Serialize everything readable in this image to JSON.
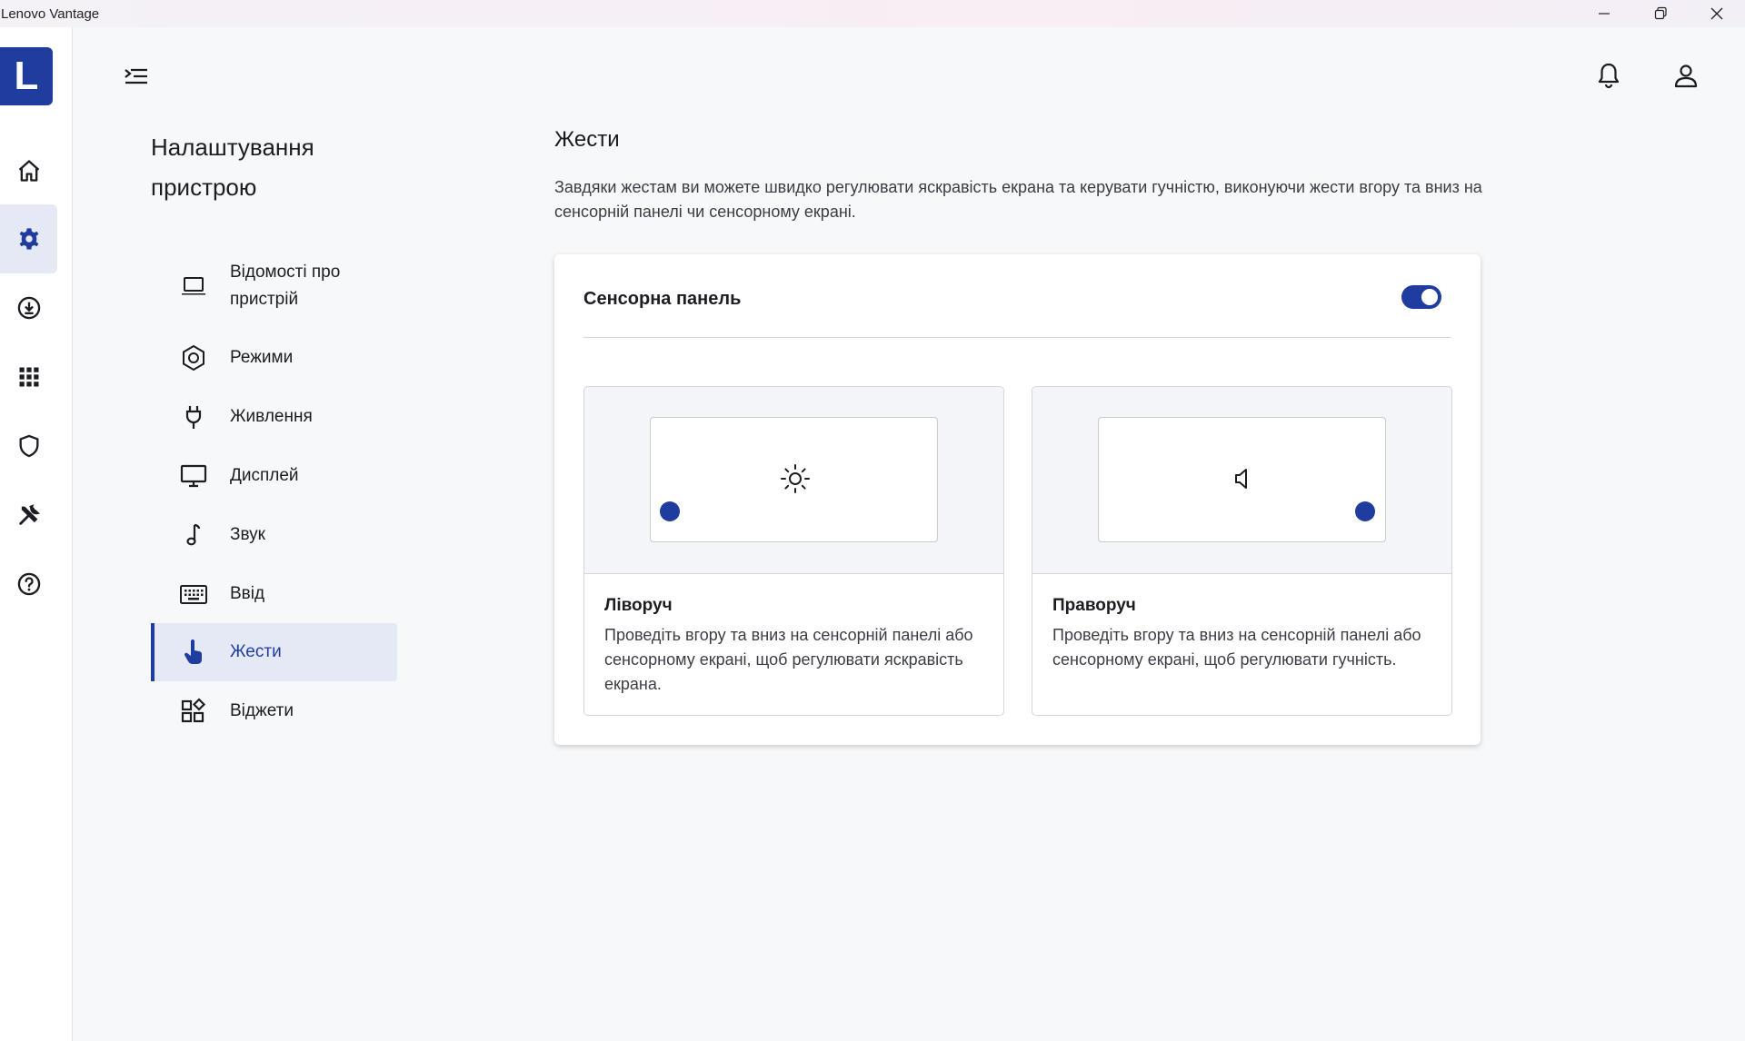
{
  "window": {
    "title": "Lenovo Vantage",
    "controls": [
      "minimize-icon",
      "restore-icon",
      "close-icon"
    ]
  },
  "rail": {
    "logo_letter": "L",
    "items": [
      {
        "icon": "home-icon",
        "active": false
      },
      {
        "icon": "gear-icon",
        "active": true
      },
      {
        "icon": "download-icon",
        "active": false
      },
      {
        "icon": "apps-grid-icon",
        "active": false
      },
      {
        "icon": "shield-icon",
        "active": false
      },
      {
        "icon": "tools-icon",
        "active": false
      },
      {
        "icon": "help-icon",
        "active": false
      }
    ]
  },
  "header": {
    "menu_icon": "collapse-menu-icon",
    "notifications_icon": "bell-icon",
    "account_icon": "user-icon"
  },
  "sidebar": {
    "title": "Налаштування пристрою",
    "items": [
      {
        "label": "Відомості про пристрій",
        "icon": "laptop-icon"
      },
      {
        "label": "Режими",
        "icon": "hexagon-icon"
      },
      {
        "label": "Живлення",
        "icon": "plug-icon"
      },
      {
        "label": "Дисплей",
        "icon": "monitor-icon"
      },
      {
        "label": "Звук",
        "icon": "music-note-icon"
      },
      {
        "label": "Ввід",
        "icon": "keyboard-icon"
      },
      {
        "label": "Жести",
        "icon": "touch-hand-icon",
        "active": true
      },
      {
        "label": "Віджети",
        "icon": "widgets-icon"
      }
    ]
  },
  "main": {
    "heading": "Жести",
    "description": "Завдяки жестам ви можете швидко регулювати яскравість екрана та керувати гучністю, виконуючи жести вгору та вниз на сенсорній панелі чи сенсорному екрані.",
    "card": {
      "title": "Сенсорна панель",
      "toggle_on": true,
      "options": [
        {
          "title": "Ліворуч",
          "description": "Проведіть вгору та вниз на сенсорній панелі або сенсорному екрані, щоб регулювати яскравість екрана.",
          "icon": "brightness-icon",
          "dot_side": "left"
        },
        {
          "title": "Праворуч",
          "description": "Проведіть вгору та вниз на сенсорній панелі або сенсорному екрані, щоб регулювати гучність.",
          "icon": "speaker-icon",
          "dot_side": "right"
        }
      ]
    }
  },
  "colors": {
    "accent": "#1f3d9e",
    "active_bg": "#e5e9f5",
    "background": "#f7f8fa"
  }
}
